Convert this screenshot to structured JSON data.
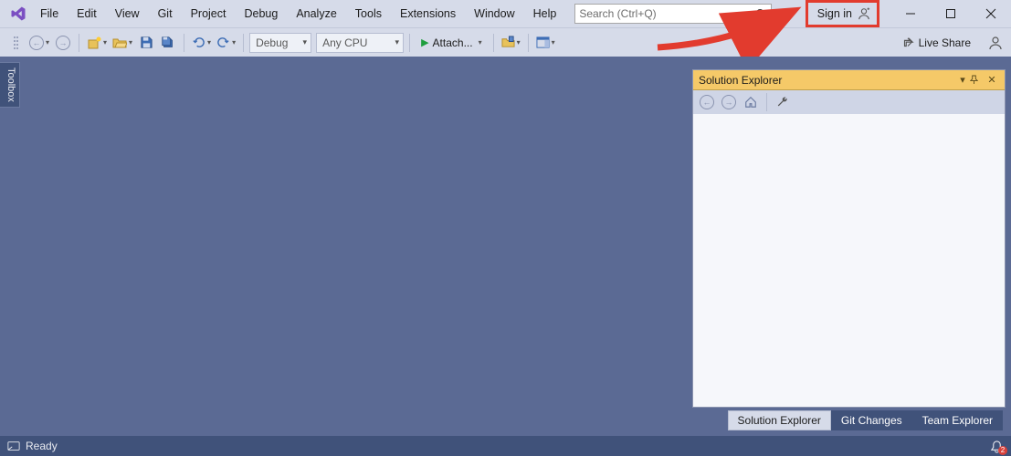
{
  "menu": {
    "items": [
      {
        "label": "File"
      },
      {
        "label": "Edit"
      },
      {
        "label": "View"
      },
      {
        "label": "Git"
      },
      {
        "label": "Project"
      },
      {
        "label": "Debug"
      },
      {
        "label": "Analyze"
      },
      {
        "label": "Tools"
      },
      {
        "label": "Extensions"
      },
      {
        "label": "Window"
      },
      {
        "label": "Help"
      }
    ]
  },
  "search": {
    "placeholder": "Search (Ctrl+Q)"
  },
  "signin": {
    "label": "Sign in"
  },
  "toolbar": {
    "config_combo": "Debug",
    "platform_combo": "Any CPU",
    "start_label": "Attach...",
    "live_share": "Live Share"
  },
  "toolbox": {
    "label": "Toolbox"
  },
  "solution_explorer": {
    "title": "Solution Explorer"
  },
  "bottom_tabs": {
    "items": [
      {
        "label": "Solution Explorer"
      },
      {
        "label": "Git Changes"
      },
      {
        "label": "Team Explorer"
      }
    ]
  },
  "statusbar": {
    "ready": "Ready",
    "notifications": "2"
  },
  "annotation": {
    "highlight_target": "sign-in-button"
  }
}
